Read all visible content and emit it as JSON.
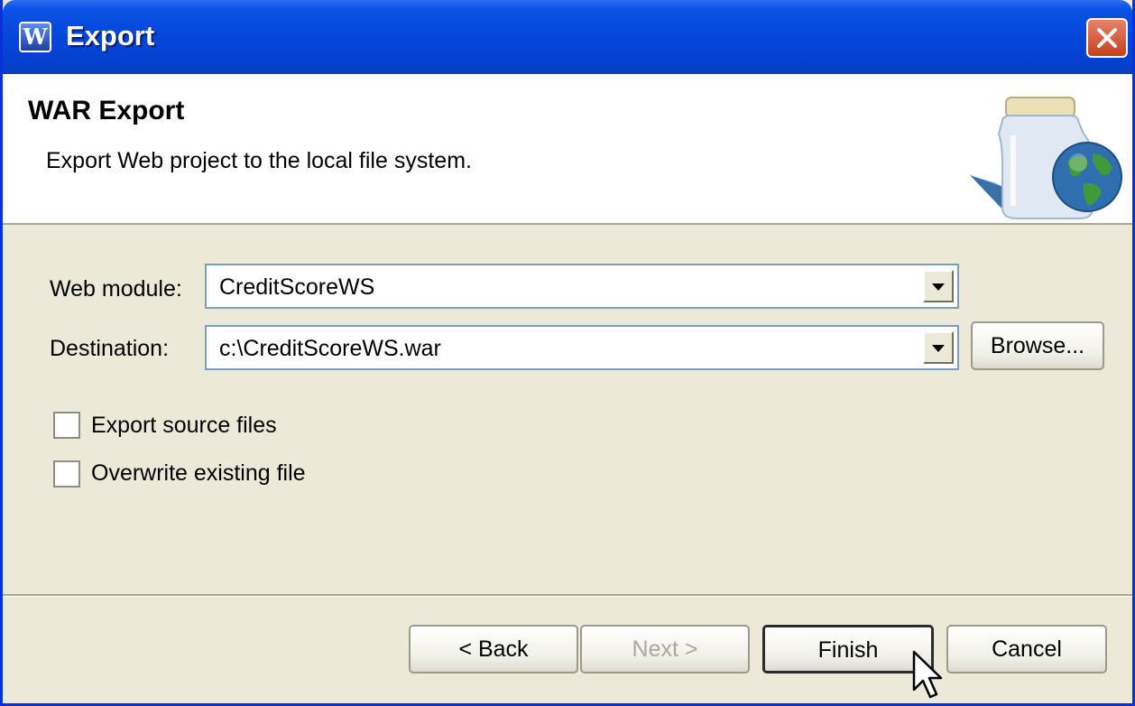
{
  "window": {
    "title": "Export",
    "app_icon": "W",
    "close_icon": "close-icon"
  },
  "banner": {
    "title": "WAR Export",
    "description": "Export Web project to the local file system.",
    "image_icon": "jar-globe-icon"
  },
  "form": {
    "web_module_label": "Web module:",
    "web_module_value": "CreditScoreWS",
    "destination_label": "Destination:",
    "destination_value": "c:\\CreditScoreWS.war",
    "browse_label": "Browse...",
    "export_source_label": "Export source files",
    "export_source_checked": false,
    "overwrite_label": "Overwrite existing file",
    "overwrite_checked": false
  },
  "buttons": {
    "back": "< Back",
    "next": "Next >",
    "finish": "Finish",
    "cancel": "Cancel"
  },
  "colors": {
    "titlebar": "#0546d8",
    "dialog_bg": "#ece9d8",
    "close_button": "#c6401e"
  }
}
